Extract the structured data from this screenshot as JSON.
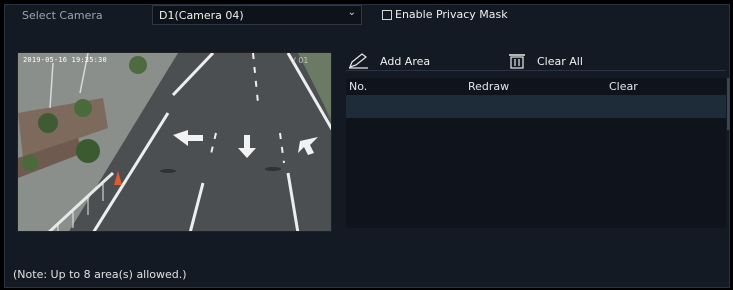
{
  "camera_row": {
    "label": "Select Camera",
    "selected": "D1(Camera 04)",
    "privacy_label": "Enable Privacy Mask",
    "privacy_checked": false
  },
  "video": {
    "timestamp": "2019-05-16 19:35:30",
    "corner_text": "/ 01"
  },
  "toolbar": {
    "add_area": "Add Area",
    "clear_all": "Clear All"
  },
  "table": {
    "columns": [
      "No.",
      "Redraw",
      "Clear"
    ]
  },
  "note": "(Note: Up to 8 area(s) allowed.)",
  "colors": {
    "background": "#141a24",
    "selected_row": "#1e2c3a",
    "text": "#f0f0f0"
  }
}
